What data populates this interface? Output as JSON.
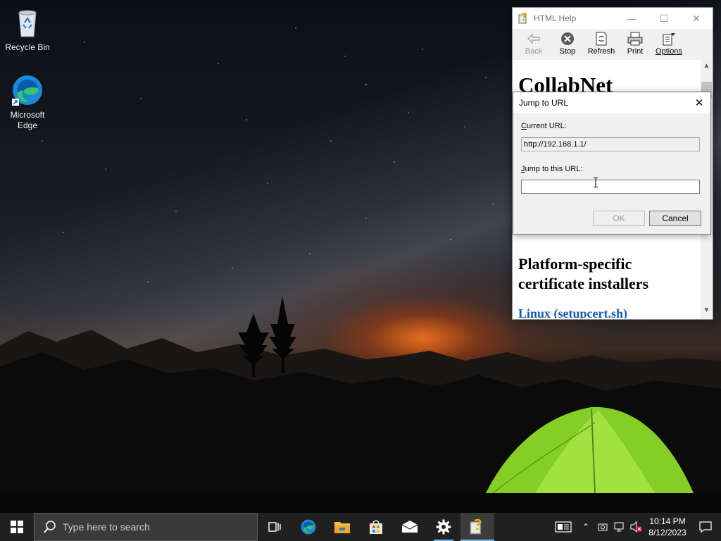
{
  "desktop": {
    "icons": [
      {
        "label": "Recycle Bin",
        "icon": "recycle-bin-icon"
      },
      {
        "label": "Microsoft Edge",
        "icon": "edge-icon"
      }
    ]
  },
  "help_window": {
    "title": "HTML Help",
    "toolbar": {
      "back": "Back",
      "stop": "Stop",
      "refresh": "Refresh",
      "print": "Print",
      "options": "Options"
    },
    "content": {
      "heading1": "CollabNet",
      "heading2": "Platform-specific certificate installers",
      "link": "Linux (setupcert.sh)"
    }
  },
  "dialog": {
    "title": "Jump to URL",
    "current_url_label": "Current URL:",
    "current_url_value": "http://192.168.1.1/",
    "jump_label": "Jump to this URL:",
    "jump_value": "",
    "ok": "OK",
    "cancel": "Cancel"
  },
  "taskbar": {
    "search_placeholder": "Type here to search",
    "time": "10:14 PM",
    "date": "8/12/2023"
  },
  "colors": {
    "taskbar_bg": "#202020",
    "accent": "#76b9ed",
    "link": "#1a5aa8",
    "tent_green": "#8fe02a"
  }
}
